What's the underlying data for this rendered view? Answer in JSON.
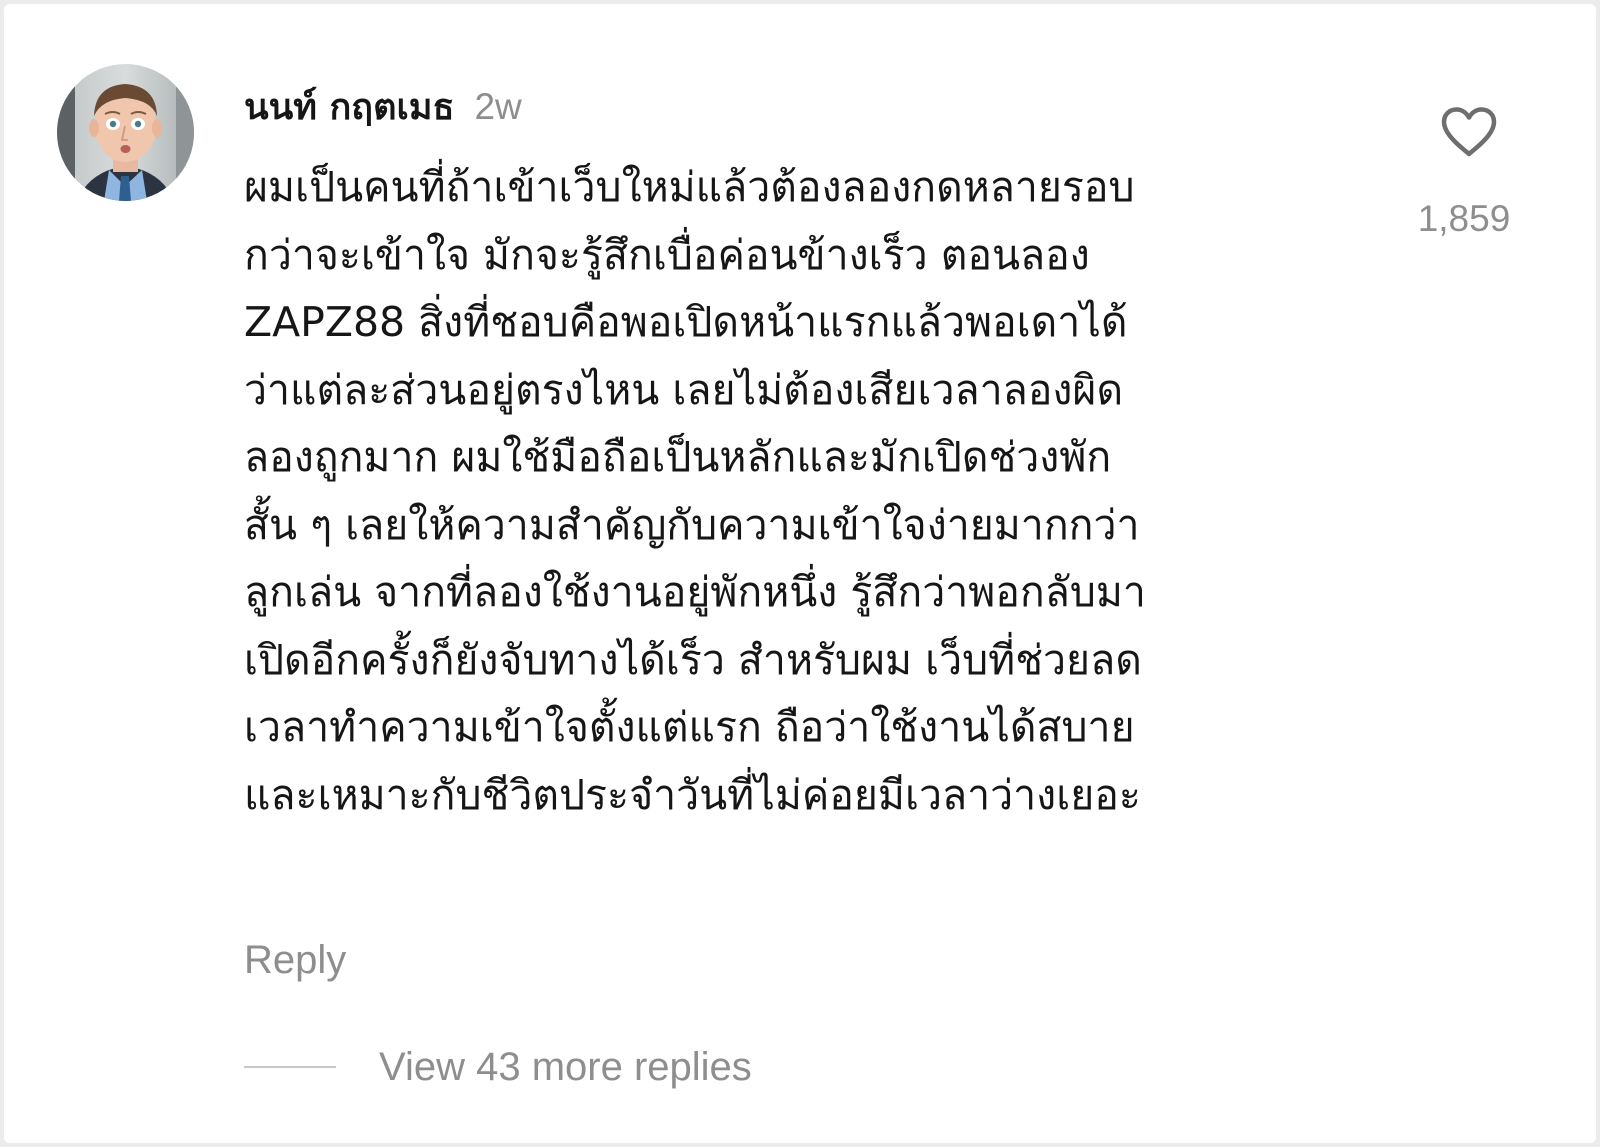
{
  "comment": {
    "username": "นนท์ กฤตเมธ",
    "time_ago": "2w",
    "text": "ผมเป็นคนที่ถ้าเข้าเว็บใหม่แล้วต้องลองกดหลายรอบ\nกว่าจะเข้าใจ มักจะรู้สึกเบื่อค่อนข้างเร็ว ตอนลอง\nZAPZ88 สิ่งที่ชอบคือพอเปิดหน้าแรกแล้วพอเดาได้\nว่าแต่ละส่วนอยู่ตรงไหน เลยไม่ต้องเสียเวลาลองผิด\nลองถูกมาก ผมใช้มือถือเป็นหลักและมักเปิดช่วงพัก\nสั้น ๆ เลยให้ความสำคัญกับความเข้าใจง่ายมากกว่า\nลูกเล่น จากที่ลองใช้งานอยู่พักหนึ่ง รู้สึกว่าพอกลับมา\nเปิดอีกครั้งก็ยังจับทางได้เร็ว สำหรับผม เว็บที่ช่วยลด\nเวลาทำความเข้าใจตั้งแต่แรก ถือว่าใช้งานได้สบาย\nและเหมาะกับชีวิตประจำวันที่ไม่ค่อยมีเวลาว่างเยอะ",
    "like_count": "1,859",
    "like_icon": "heart-outline-icon",
    "reply_label": "Reply",
    "view_replies_label": "View 43 more replies"
  },
  "colors": {
    "text_primary": "#161616",
    "text_secondary": "#8e8e8e",
    "divider": "#c7c7c7",
    "background": "#ffffff"
  }
}
